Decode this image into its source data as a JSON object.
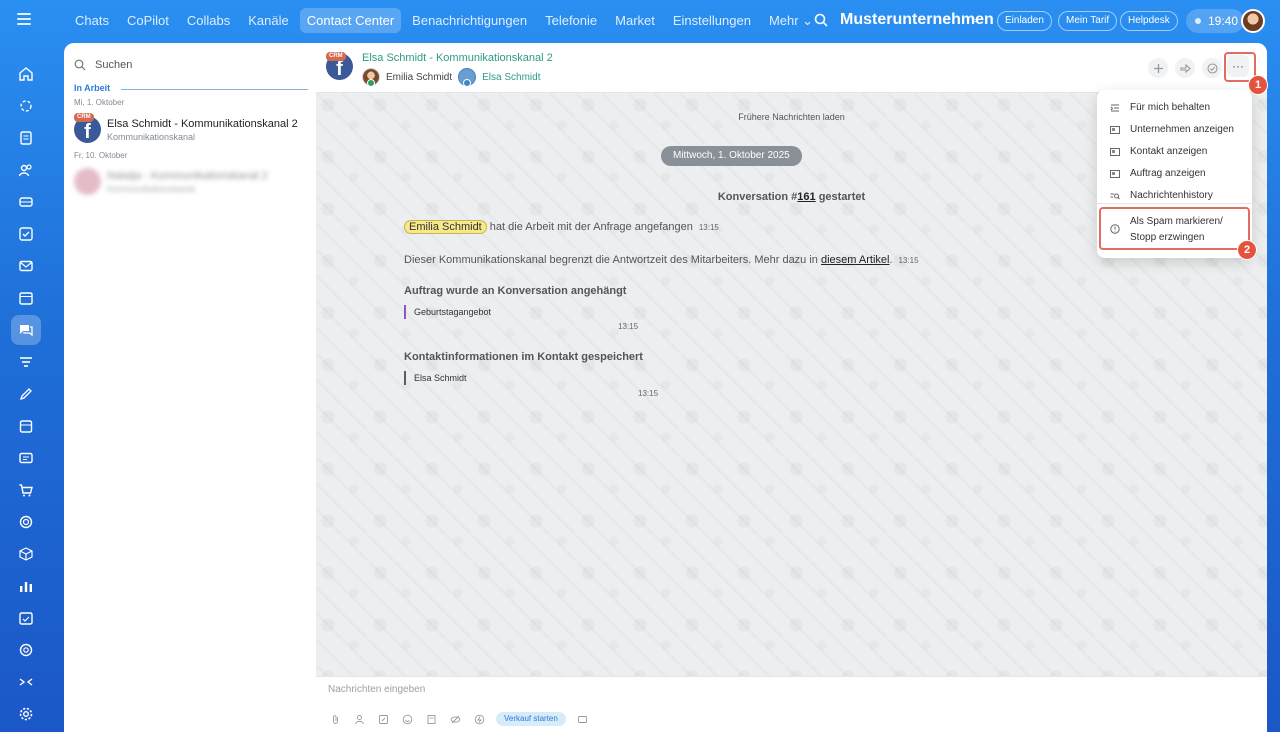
{
  "topnav": {
    "items": [
      {
        "label": "Chats"
      },
      {
        "label": "CoPilot"
      },
      {
        "label": "Collabs"
      },
      {
        "label": "Kanäle"
      },
      {
        "label": "Contact Center",
        "active": true
      },
      {
        "label": "Benachrichtigungen"
      },
      {
        "label": "Telefonie"
      },
      {
        "label": "Market"
      },
      {
        "label": "Einstellungen"
      },
      {
        "label": "Mehr ⌄"
      }
    ],
    "company": "Musterunternehmen",
    "invite": "Einladen",
    "tariff": "Mein Tarif",
    "helpdesk": "Helpdesk",
    "time": "19:40"
  },
  "sidebar": {
    "search_placeholder": "Suchen",
    "section": "In Arbeit",
    "groups": [
      {
        "date": "Mi, 1. Oktober",
        "chat": {
          "title": "Elsa Schmidt - Kommunikationskanal 2",
          "subtitle": "Kommunikationskanal"
        }
      },
      {
        "date": "Fr, 10. Oktober",
        "chat": {
          "title": "Natalja - Kommunikationskanal 2",
          "subtitle": "Kommunikationskanal"
        }
      }
    ],
    "crm_tag": "CRM"
  },
  "chat": {
    "title": "Elsa Schmidt - Kommunikationskanal 2",
    "user1": "Emilia Schmidt",
    "user2": "Elsa Schmidt",
    "load_older": "Frühere Nachrichten laden",
    "date_pill": "Mittwoch, 1. Oktober 2025",
    "conv_prefix": "Konversation #",
    "conv_num": "161",
    "conv_suffix": " gestartet",
    "msg1_name": "Emilia Schmidt",
    "msg1_text": " hat die Arbeit mit der Anfrage angefangen",
    "msg1_time": "13:15",
    "msg2_text": "Dieser Kommunikationskanal begrenzt die Antwortzeit des Mitarbeiters. Mehr dazu in ",
    "msg2_link": "diesem Artikel",
    "msg2_end": ".",
    "msg2_time": "13:15",
    "block1_title": "Auftrag wurde an Konversation angehängt",
    "block1_quote": "Geburtstagangebot",
    "block1_time": "13:15",
    "block2_title": "Kontaktinformationen im Kontakt gespeichert",
    "block2_quote": "Elsa Schmidt",
    "block2_time": "13:15",
    "composer_placeholder": "Nachrichten eingeben",
    "sale_button": "Verkauf starten"
  },
  "menu": {
    "items": [
      {
        "label": "Für mich behalten",
        "icon": "pin-list-icon"
      },
      {
        "label": "Unternehmen anzeigen",
        "icon": "company-card-icon"
      },
      {
        "label": "Kontakt anzeigen",
        "icon": "contact-card-icon"
      },
      {
        "label": "Auftrag anzeigen",
        "icon": "deal-card-icon"
      },
      {
        "label": "Nachrichtenhistory",
        "icon": "history-search-icon"
      }
    ],
    "spam_line1": "Als Spam markieren/",
    "spam_line2": "Stopp erzwingen"
  },
  "callouts": {
    "one": "1",
    "two": "2"
  },
  "colors": {
    "accent": "#2a7ed8",
    "callout": "#e5533f",
    "chat_title": "#2e9a88"
  }
}
